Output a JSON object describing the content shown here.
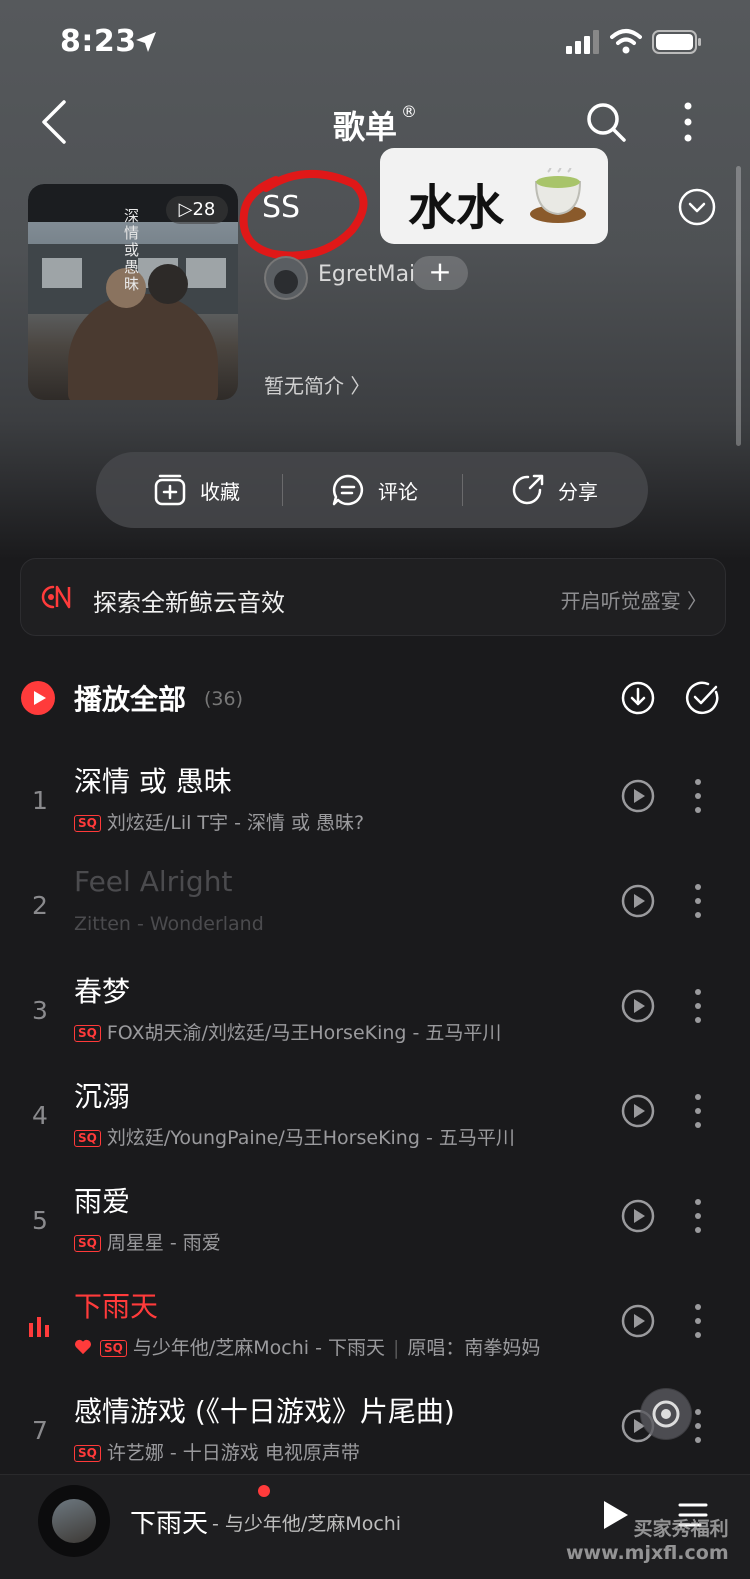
{
  "status": {
    "time": "8:23"
  },
  "nav": {
    "title": "歌单",
    "title_mark": "®"
  },
  "playlist": {
    "cover_text": "深情或愚昧",
    "play_count": "▷28",
    "name": "SS",
    "sticker_text": "水水",
    "owner": "EgretMai",
    "follow_label": "+",
    "description": "暂无简介 〉"
  },
  "actions": {
    "collect": "收藏",
    "comment": "评论",
    "share": "分享"
  },
  "promo": {
    "text": "探索全新鲸云音效",
    "cta": "开启听觉盛宴 〉"
  },
  "play_all": {
    "label": "播放全部",
    "count": "(36)"
  },
  "songs": [
    {
      "index": "1",
      "title": "深情 或 愚昧",
      "sq": "SQ",
      "meta": "刘炫廷/Lil T宇 - 深情 或 愚昧?"
    },
    {
      "index": "2",
      "title": "Feel Alright",
      "meta": "Zitten - Wonderland"
    },
    {
      "index": "3",
      "title": "春梦",
      "sq": "SQ",
      "meta": "FOX胡天渝/刘炫廷/马王HorseKing - 五马平川"
    },
    {
      "index": "4",
      "title": "沉溺",
      "sq": "SQ",
      "meta": "刘炫廷/YoungPaine/马王HorseKing - 五马平川"
    },
    {
      "index": "5",
      "title": "雨爱",
      "sq": "SQ",
      "meta": "周星星 - 雨爱"
    },
    {
      "index": "",
      "title": "下雨天",
      "sq": "SQ",
      "meta": "与少年他/芝麻Mochi - 下雨天",
      "original": "原唱：南拳妈妈"
    },
    {
      "index": "7",
      "title": "感情游戏 (《十日游戏》片尾曲)",
      "sq": "SQ",
      "meta": "许艺娜 - 十日游戏 电视原声带"
    }
  ],
  "mini_player": {
    "title": "下雨天",
    "artist": "- 与少年他/芝麻Mochi"
  },
  "watermark": {
    "line1": "买家秀福利",
    "line2": "www.mjxfl.com"
  },
  "colors": {
    "accent": "#ff3b3b",
    "background": "#1a1a1c"
  }
}
